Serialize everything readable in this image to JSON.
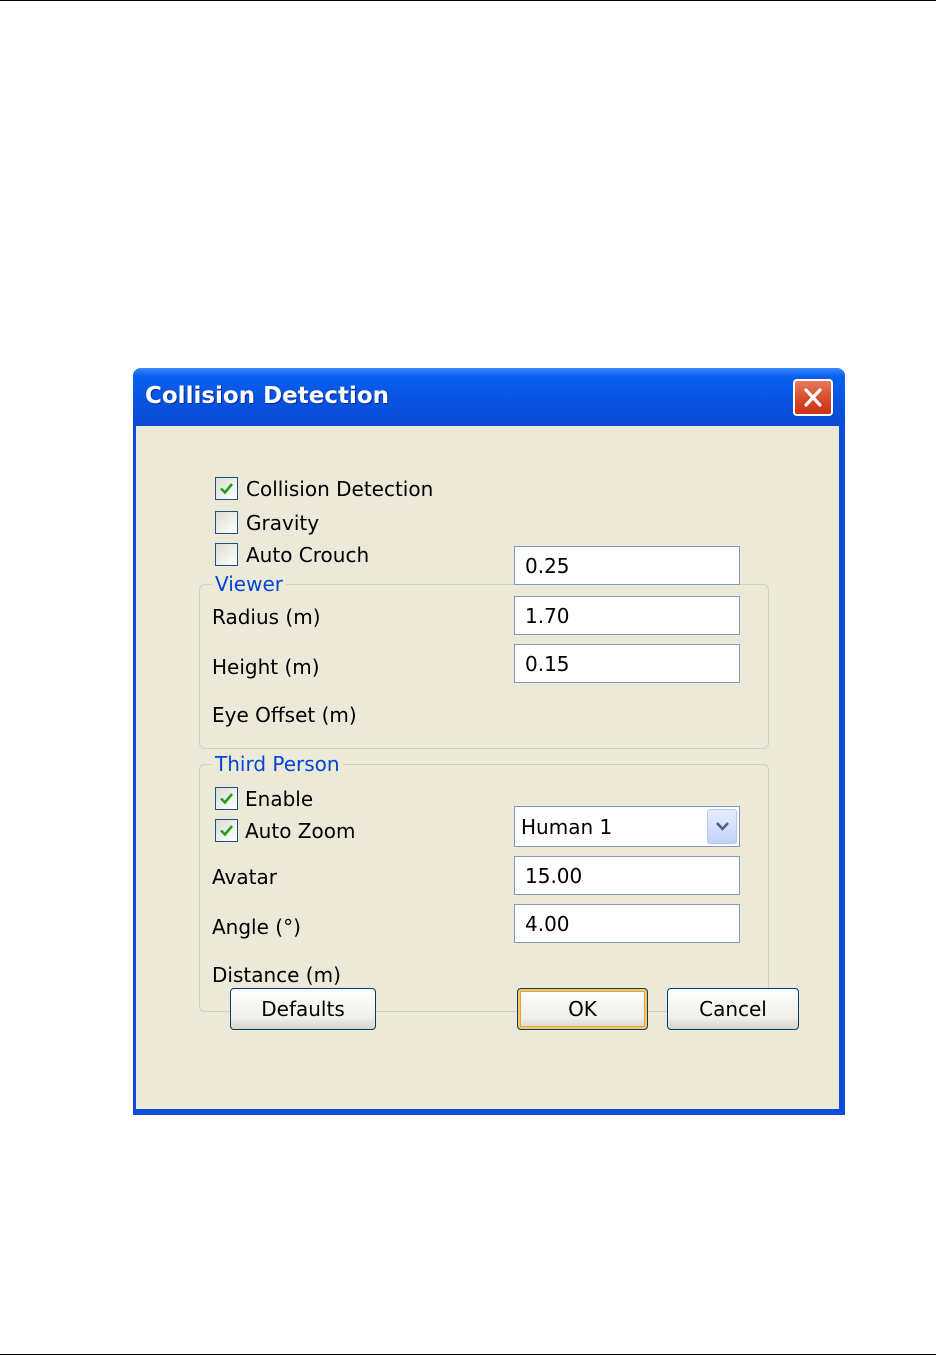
{
  "window": {
    "title": "Collision Detection",
    "close_icon": "close-icon"
  },
  "options": {
    "collision_detection": {
      "label": "Collision Detection",
      "checked": true
    },
    "gravity": {
      "label": "Gravity",
      "checked": false
    },
    "auto_crouch": {
      "label": "Auto Crouch",
      "checked": false
    }
  },
  "viewer": {
    "legend": "Viewer",
    "radius": {
      "label": "Radius (m)",
      "value": "0.25"
    },
    "height": {
      "label": "Height (m)",
      "value": "1.70"
    },
    "eye_offset": {
      "label": "Eye Offset (m)",
      "value": "0.15"
    }
  },
  "third_person": {
    "legend": "Third Person",
    "enable": {
      "label": "Enable",
      "checked": true
    },
    "auto_zoom": {
      "label": "Auto Zoom",
      "checked": true
    },
    "avatar": {
      "label": "Avatar",
      "value": "Human 1"
    },
    "angle": {
      "label": "Angle (°)",
      "value": "15.00"
    },
    "distance": {
      "label": "Distance (m)",
      "value": "4.00"
    }
  },
  "buttons": {
    "defaults": "Defaults",
    "ok": "OK",
    "cancel": "Cancel"
  },
  "colors": {
    "title_bar": "#0752e0",
    "dialog_face": "#ece9d8",
    "group_legend": "#0046d5",
    "check_mark": "#21a121"
  }
}
